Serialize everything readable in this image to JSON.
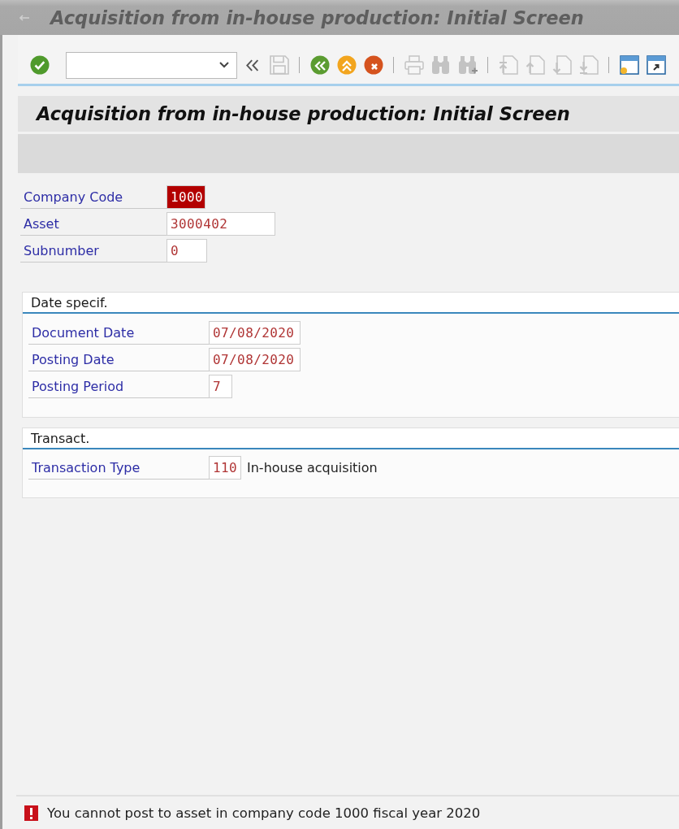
{
  "window": {
    "title": "Acquisition from in-house production: Initial Screen"
  },
  "toolbar": {
    "groups": [
      {
        "buttons": [
          {
            "kind": "enter",
            "disabled": false
          }
        ]
      },
      {
        "buttons": [
          {
            "kind": "collapse",
            "disabled": false
          },
          {
            "kind": "save",
            "disabled": true
          }
        ]
      },
      {
        "buttons": [
          {
            "kind": "back",
            "disabled": false
          },
          {
            "kind": "exit",
            "disabled": false
          },
          {
            "kind": "cancel",
            "disabled": false
          }
        ]
      },
      {
        "buttons": [
          {
            "kind": "print",
            "disabled": true
          },
          {
            "kind": "find",
            "disabled": true
          },
          {
            "kind": "find_next",
            "disabled": true
          }
        ]
      },
      {
        "buttons": [
          {
            "kind": "first_page",
            "disabled": true
          },
          {
            "kind": "previous_page",
            "disabled": true
          },
          {
            "kind": "next_page",
            "disabled": true
          },
          {
            "kind": "last_page",
            "disabled": true
          }
        ]
      },
      {
        "buttons": [
          {
            "kind": "new_session",
            "disabled": false
          },
          {
            "kind": "shortcut",
            "disabled": false
          }
        ]
      }
    ]
  },
  "screen": {
    "title": "Acquisition from in-house production: Initial Screen"
  },
  "header_fields": [
    {
      "label": "Company Code",
      "value": "1000",
      "highlighted": true
    },
    {
      "label": "Asset",
      "value": "3000402",
      "highlighted": false
    },
    {
      "label": "Subnumber",
      "value": "0",
      "highlighted": false
    }
  ],
  "groups": [
    {
      "title": "Date specif.",
      "fields": [
        {
          "label": "Document Date",
          "value": "07/08/2020",
          "highlighted": false
        },
        {
          "label": "Posting Date",
          "value": "07/08/2020",
          "highlighted": false
        },
        {
          "label": "Posting Period",
          "value": "7",
          "highlighted": false
        }
      ]
    },
    {
      "title": "Transact.",
      "fields": [
        {
          "label": "Transaction Type",
          "value": "110",
          "highlighted": false,
          "description": "In-house acquisition"
        }
      ]
    }
  ],
  "status_bar": {
    "kind": "error",
    "message": "You cannot post to asset in company code 1000 fiscal year 2020"
  }
}
